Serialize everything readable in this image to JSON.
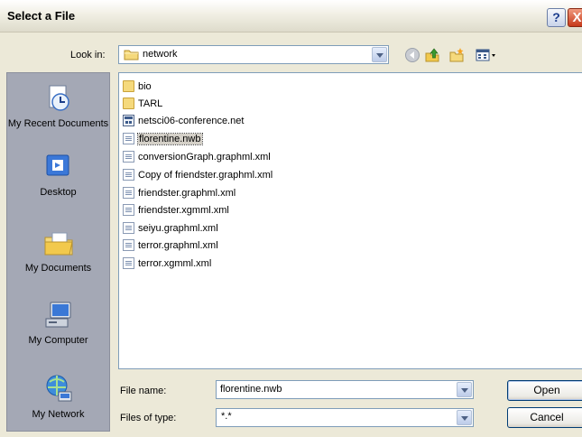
{
  "window": {
    "title": "Select a File",
    "help_label": "?",
    "close_label": "X"
  },
  "lookin": {
    "label": "Look in:",
    "value": "network"
  },
  "places": [
    {
      "label": "My Recent Documents",
      "icon": "recent-documents-icon"
    },
    {
      "label": "Desktop",
      "icon": "desktop-icon"
    },
    {
      "label": "My Documents",
      "icon": "my-documents-icon"
    },
    {
      "label": "My Computer",
      "icon": "my-computer-icon"
    },
    {
      "label": "My Network",
      "icon": "my-network-icon"
    }
  ],
  "files": [
    {
      "name": "bio",
      "type": "folder"
    },
    {
      "name": "TARL",
      "type": "folder"
    },
    {
      "name": "netsci06-conference.net",
      "type": "net"
    },
    {
      "name": "florentine.nwb",
      "type": "doc",
      "selected": true
    },
    {
      "name": "conversionGraph.graphml.xml",
      "type": "doc"
    },
    {
      "name": "Copy of friendster.graphml.xml",
      "type": "doc"
    },
    {
      "name": "friendster.graphml.xml",
      "type": "doc"
    },
    {
      "name": "friendster.xgmml.xml",
      "type": "doc"
    },
    {
      "name": "seiyu.graphml.xml",
      "type": "doc"
    },
    {
      "name": "terror.graphml.xml",
      "type": "doc"
    },
    {
      "name": "terror.xgmml.xml",
      "type": "doc"
    }
  ],
  "filename": {
    "label": "File name:",
    "value": "florentine.nwb"
  },
  "filetype": {
    "label": "Files of type:",
    "value": "*.*"
  },
  "buttons": {
    "open": "Open",
    "cancel": "Cancel"
  }
}
